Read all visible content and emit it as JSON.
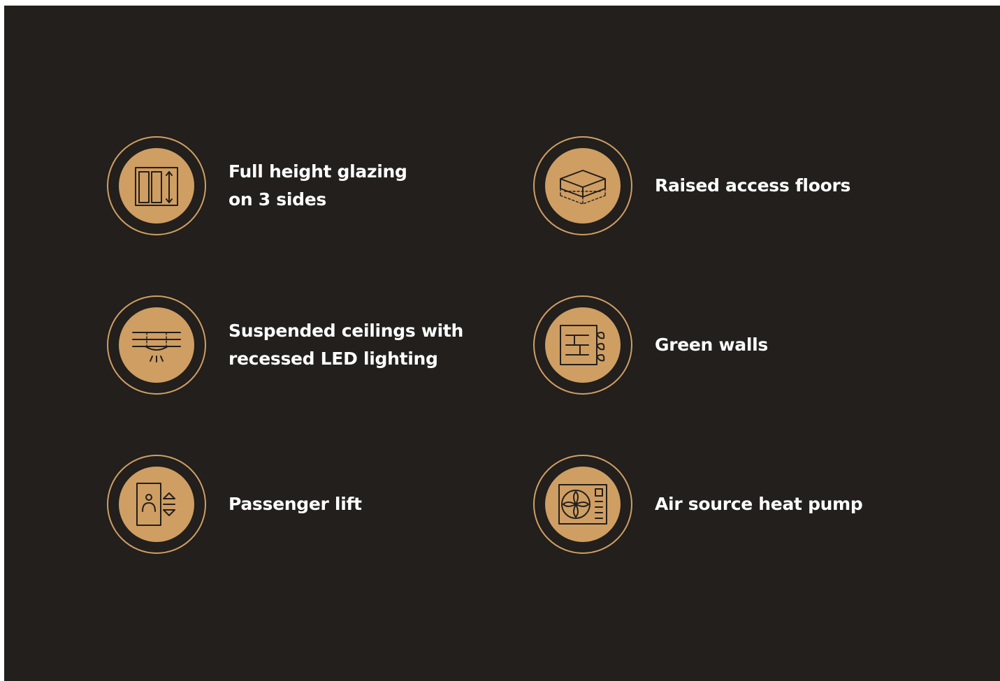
{
  "features": [
    {
      "line1": "Full height glazing",
      "line2": "on 3 sides",
      "icon": "glazing-window-icon"
    },
    {
      "line1": "Raised access floors",
      "line2": "",
      "icon": "raised-floor-box-icon"
    },
    {
      "line1": "Suspended ceilings with",
      "line2": "recessed LED lighting",
      "icon": "ceiling-light-icon"
    },
    {
      "line1": "Green walls",
      "line2": "",
      "icon": "green-wall-icon"
    },
    {
      "line1": "Passenger lift",
      "line2": "",
      "icon": "passenger-lift-icon"
    },
    {
      "line1": "Air source heat pump",
      "line2": "",
      "icon": "heat-pump-fan-icon"
    }
  ],
  "colors": {
    "background": "#221f1c",
    "accent": "#cf9e63",
    "text": "#ffffff"
  }
}
